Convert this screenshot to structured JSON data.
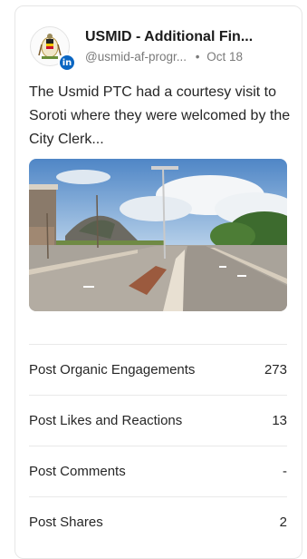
{
  "post": {
    "account_name": "USMID - Additional Fin...",
    "handle": "@usmid-af-progr...",
    "separator": "•",
    "date": "Oct 18",
    "network_badge": "in",
    "text": "The Usmid PTC had a courtesy visit to Soroti where they were welcomed by the City Clerk..."
  },
  "metrics": [
    {
      "label": "Post Organic Engagements",
      "value": "273"
    },
    {
      "label": "Post Likes and Reactions",
      "value": "13"
    },
    {
      "label": "Post Comments",
      "value": "-"
    },
    {
      "label": "Post Shares",
      "value": "2"
    }
  ],
  "colors": {
    "linkedin_blue": "#0a66c2",
    "border": "#e6e6e6",
    "muted_text": "#7a7a7a"
  }
}
